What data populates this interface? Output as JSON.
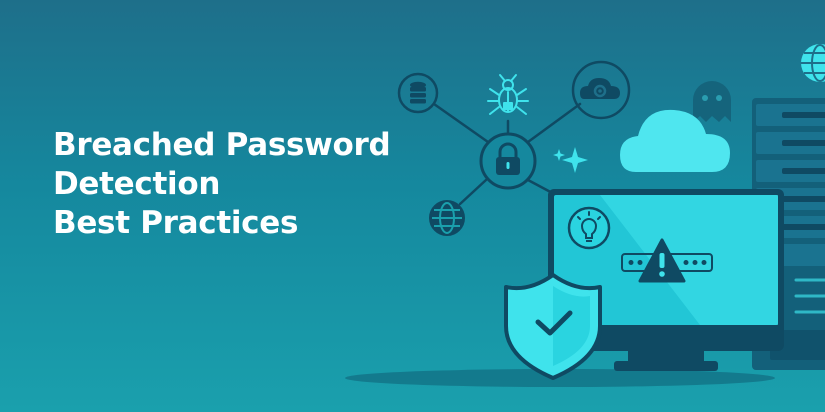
{
  "banner": {
    "title_lines": [
      "Breached Password",
      "Detection",
      "Best Practices"
    ]
  },
  "colors": {
    "background_top": "#1e6f8a",
    "background_bottom": "#1aa0ad",
    "accent_cyan": "#3fe3ec",
    "icon_dark": "#0f4a63",
    "title_text": "#ffffff",
    "server_panel": "#13607a"
  },
  "icons": [
    "database-icon",
    "bug-icon",
    "cloud-settings-icon",
    "lock-icon",
    "sparkle-icon",
    "globe-icon",
    "ghost-icon",
    "cloud-icon",
    "lightbulb-icon",
    "warning-icon",
    "shield-check-icon",
    "monitor-icon",
    "server-rack-icon"
  ]
}
